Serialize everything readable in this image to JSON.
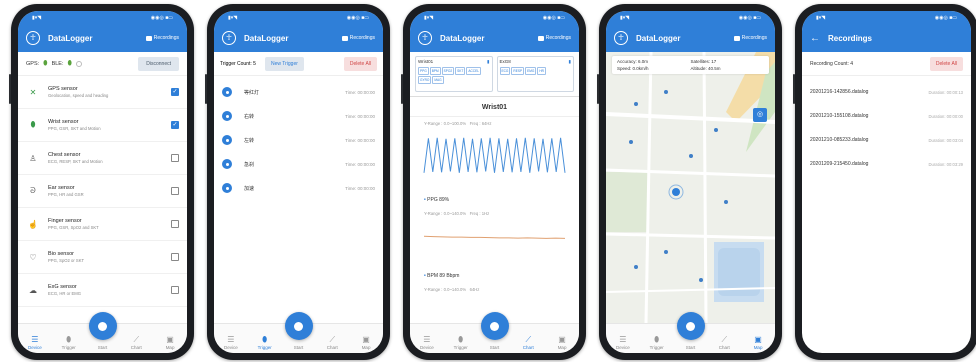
{
  "status": {
    "left": "▮▾◥",
    "right": "◉◉◎ ■▭"
  },
  "app_title": "DataLogger",
  "recordings_btn": "Recordings",
  "nav": [
    "Device",
    "Trigger",
    "Start",
    "Chart",
    "Map"
  ],
  "device": {
    "gps_label": "GPS:",
    "ble_label": "BLE:",
    "disconnect_label": "Disconnect",
    "sensors": [
      {
        "name": "GPS sensor",
        "desc": "Geolocation, speed and heading",
        "checked": true
      },
      {
        "name": "Wrist sensor",
        "desc": "PPG, GSR, SKT and Motion",
        "checked": true
      },
      {
        "name": "Chest sensor",
        "desc": "ECG, RESP, SKT and Motion",
        "checked": false
      },
      {
        "name": "Ear sensor",
        "desc": "PPG, HR and GSR",
        "checked": false
      },
      {
        "name": "Finger sensor",
        "desc": "PPG, GSR, SpO2 and SKT",
        "checked": false
      },
      {
        "name": "Bio sensor",
        "desc": "PPG, SpO2 or SKT",
        "checked": false
      },
      {
        "name": "ExG sensor",
        "desc": "ECG, HR or EMG",
        "checked": false
      }
    ]
  },
  "trigger": {
    "count": "Trigger Count: 5",
    "new_label": "New Trigger",
    "delete_label": "Delete All",
    "items": [
      {
        "name": "等红灯",
        "time": "Time: 00:00:00"
      },
      {
        "name": "右转",
        "time": "Time: 00:00:00"
      },
      {
        "name": "左转",
        "time": "Time: 00:00:00"
      },
      {
        "name": "急刹",
        "time": "Time: 00:00:00"
      },
      {
        "name": "加速",
        "time": "Time: 00:00:00"
      }
    ]
  },
  "chart": {
    "card1_title": "Wrist01",
    "card2_title": "ExG8",
    "card1_chips": [
      "PPG",
      "BPM",
      "SPO2",
      "SKT",
      "ACCEL",
      "GYRO",
      "MAG"
    ],
    "card2_chips": [
      "ECG",
      "RESP",
      "EMG",
      "HR"
    ],
    "device_title": "Wrist01",
    "range1": "Y-Range : 0.0~100.0%",
    "freq1": "Freq : 64Hz",
    "series1": "PPG 89%",
    "range2": "Y-Range : 0.0~140.0%",
    "freq2": "Freq : 1Hz",
    "series2": "BPM 89 Bbpm",
    "range3": "Y-Range : 0.0~140.0%",
    "freq3": "64Hz"
  },
  "chart_data": [
    {
      "type": "line",
      "series": [
        {
          "values": [
            20,
            95,
            22,
            96,
            21,
            94,
            23,
            95,
            20,
            96,
            22,
            94,
            21,
            95,
            23,
            96,
            20,
            95,
            22,
            94,
            21,
            95,
            22,
            96,
            20,
            95,
            23,
            94,
            21,
            95,
            22,
            96,
            20
          ]
        }
      ],
      "ylim": [
        0,
        100
      ]
    },
    {
      "type": "line",
      "series": [
        {
          "values": [
            92,
            91,
            90,
            89,
            89,
            88,
            88,
            87,
            86,
            86,
            85,
            86,
            85,
            84,
            85,
            84
          ]
        }
      ],
      "ylim": [
        0,
        140
      ]
    }
  ],
  "map": {
    "accuracy": "Accuracy: 6.0m",
    "satellites": "Satellites: 17",
    "speed": "Speed: 0.0km/h",
    "altitude": "Altitude: 40.5m"
  },
  "recordings": {
    "title": "Recordings",
    "count": "Recording Count: 4",
    "delete_label": "Delete All",
    "files": [
      {
        "name": "20201216-142856.datalog",
        "duration": "Duration: 00:00:13"
      },
      {
        "name": "20201210-155108.datalog",
        "duration": "Duration: 00:00:00"
      },
      {
        "name": "20201210-085233.datalog",
        "duration": "Duration: 00:03:04"
      },
      {
        "name": "20201209-215450.datalog",
        "duration": "Duration: 00:03:29"
      }
    ]
  },
  "colors": {
    "primary": "#2f7fd8",
    "danger": "#d04545",
    "ppg_line": "#4a90d9",
    "bpm_line": "#e0a070"
  }
}
